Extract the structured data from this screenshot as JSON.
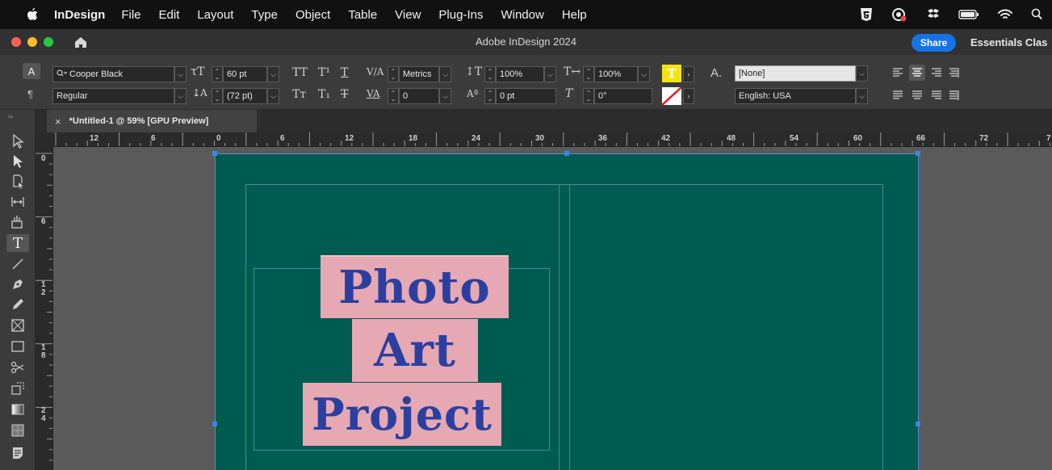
{
  "menubar": {
    "app_name": "InDesign",
    "items": [
      "File",
      "Edit",
      "Layout",
      "Type",
      "Object",
      "Table",
      "View",
      "Plug-Ins",
      "Window",
      "Help"
    ],
    "status_icons": [
      "html5-icon",
      "creative-cloud-icon",
      "dropbox-icon",
      "battery-icon",
      "wifi-icon",
      "search-icon"
    ]
  },
  "titlebar": {
    "title": "Adobe InDesign 2024",
    "share_label": "Share",
    "workspace_label": "Essentials Clas"
  },
  "control": {
    "mode_char": "A",
    "mode_para": "¶",
    "font_family": "Cooper Black",
    "font_style": "Regular",
    "font_size": "60 pt",
    "leading": "(72 pt)",
    "kerning": "Metrics",
    "tracking": "0",
    "vertical_scale": "100%",
    "horizontal_scale": "100%",
    "baseline_shift": "0 pt",
    "skew": "0°",
    "char_style": "[None]",
    "language": "English: USA",
    "fill_color": "#f5e31a"
  },
  "document": {
    "tab_title": "*Untitled-1 @ 59% [GPU Preview]",
    "page_color": "#005b50",
    "words": [
      "Photo",
      "Art",
      "Project"
    ],
    "word_bg": "#e6a8b2",
    "word_color": "#2b3fa0"
  },
  "rulers": {
    "h_labels": [
      "12",
      "6",
      "0",
      "6",
      "12",
      "18",
      "24",
      "30",
      "36",
      "42",
      "48",
      "54",
      "60",
      "66",
      "72",
      "7"
    ],
    "v_labels": [
      "0",
      "6",
      "12",
      "18",
      "24"
    ]
  }
}
